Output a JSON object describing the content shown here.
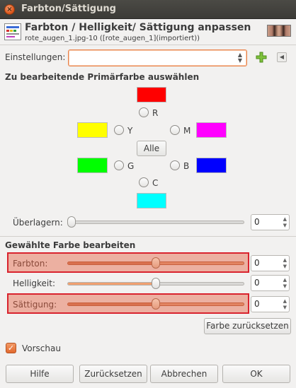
{
  "window": {
    "title": "Farbton/Sättigung",
    "close_icon": "close-icon"
  },
  "header": {
    "title": "Farbton / Helligkeit/ Sättigung anpassen",
    "subtitle": "rote_augen_1.jpg-10 ([rote_augen_1](importiert))",
    "icon": "hue-saturation-icon",
    "thumbnail": "image-thumbnail"
  },
  "presets": {
    "label": "Einstellungen:",
    "value": "",
    "add_icon": "plus-icon",
    "menu_icon": "chevron-left-icon"
  },
  "primary": {
    "section_title": "Zu bearbeitende Primärfarbe auswählen",
    "colors": {
      "R": "#ff0000",
      "Y": "#ffff00",
      "M": "#ff00ff",
      "G": "#00ff00",
      "B": "#0000ff",
      "C": "#00ffff"
    },
    "labels": {
      "R": "R",
      "Y": "Y",
      "M": "M",
      "G": "G",
      "B": "B",
      "C": "C"
    },
    "all_button": "Alle"
  },
  "overlap": {
    "label": "Überlagern:",
    "value": "0",
    "slider_fraction": 0.0
  },
  "edit": {
    "section_title": "Gewählte Farbe bearbeiten",
    "hue": {
      "label": "Farbton:",
      "value": "0",
      "slider_fraction": 0.5
    },
    "lightness": {
      "label": "Helligkeit:",
      "value": "0",
      "slider_fraction": 0.5
    },
    "saturation": {
      "label": "Sättigung:",
      "value": "0",
      "slider_fraction": 0.5
    },
    "reset_color_button": "Farbe zurücksetzen",
    "highlight_color": "#d9232e"
  },
  "preview": {
    "label": "Vorschau",
    "checked": true
  },
  "buttons": {
    "help": "Hilfe",
    "reset": "Zurücksetzen",
    "cancel": "Abbrechen",
    "ok": "OK"
  },
  "accent_color": "#e9824a"
}
